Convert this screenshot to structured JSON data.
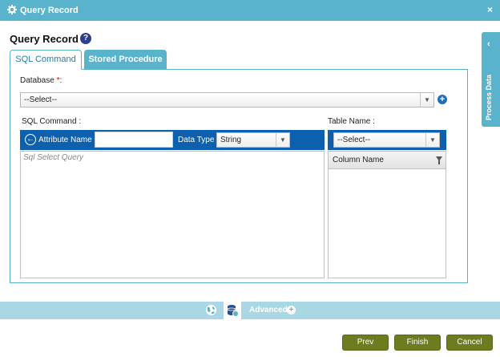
{
  "window": {
    "title": "Query Record",
    "close_label": "×"
  },
  "page": {
    "title": "Query Record",
    "help_label": "?"
  },
  "tabs": [
    {
      "label": "SQL Command",
      "active": true
    },
    {
      "label": "Stored Procedure",
      "active": false
    }
  ],
  "database": {
    "label": "Database ",
    "required_mark": "*",
    "colon": ":",
    "selected": "--Select--",
    "add_label": "+"
  },
  "sql_command": {
    "label": "SQL Command :",
    "back_label": "←",
    "attribute_name_label": "Attribute Name",
    "attribute_name_value": "",
    "data_type_label": "Data Type",
    "data_type_selected": "String",
    "query_value": "",
    "query_placeholder": "Sql Select Query"
  },
  "table_name": {
    "label": "Table Name :",
    "selected": "--Select--",
    "column_header": "Column Name"
  },
  "side_panel": {
    "label": "Process Data",
    "chevron": "‹"
  },
  "bottom_bar": {
    "advanced_label": "Advanced",
    "plus_label": "+"
  },
  "buttons": {
    "prev": "Prev",
    "finish": "Finish",
    "cancel": "Cancel"
  },
  "colors": {
    "accent": "#5ab3cc",
    "toolbar_blue": "#0d60ad",
    "button_olive": "#6e7c20",
    "required": "#dd0000"
  }
}
